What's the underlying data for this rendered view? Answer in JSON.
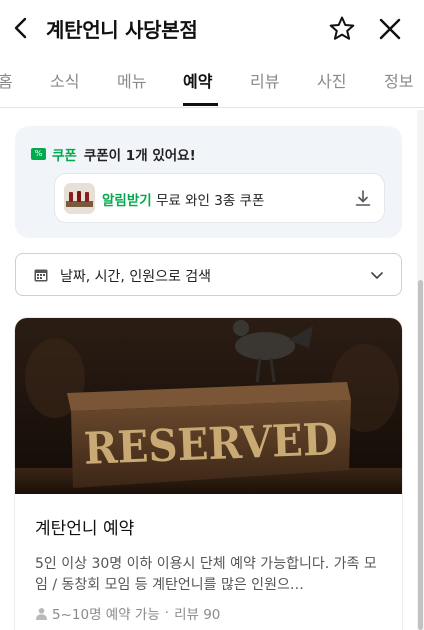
{
  "header": {
    "title": "계탄언니 사당본점"
  },
  "tabs": [
    {
      "label": "홈"
    },
    {
      "label": "소식"
    },
    {
      "label": "메뉴"
    },
    {
      "label": "예약"
    },
    {
      "label": "리뷰"
    },
    {
      "label": "사진"
    },
    {
      "label": "정보"
    }
  ],
  "active_tab": "예약",
  "coupon": {
    "badge": "%",
    "label": "쿠폰",
    "count_text": "쿠폰이 1개 있어요!",
    "card": {
      "highlight": "알림받기",
      "rest": " 무료 와인 3종 쿠폰"
    }
  },
  "search": {
    "placeholder": "날짜, 시간, 인원으로 검색"
  },
  "reservation_card": {
    "image_text": "RESERVED",
    "title": "계탄언니 예약",
    "description": "5인 이상 30명 이하 이용시 단체 예약 가능합니다. 가족 모임 / 동창회 모임 등 계탄언니를 많은 인원으…",
    "capacity": "5~10명 예약 가능",
    "separator": "·",
    "reviews": "리뷰 90"
  },
  "colors": {
    "accent_green": "#03a94d",
    "coupon_bg": "#f1f4f8",
    "text_muted": "#8a8a8a"
  },
  "icons": [
    "back-arrow-icon",
    "star-icon",
    "close-icon",
    "percent-badge-icon",
    "download-icon",
    "calendar-icon",
    "chevron-down-icon",
    "person-icon"
  ]
}
